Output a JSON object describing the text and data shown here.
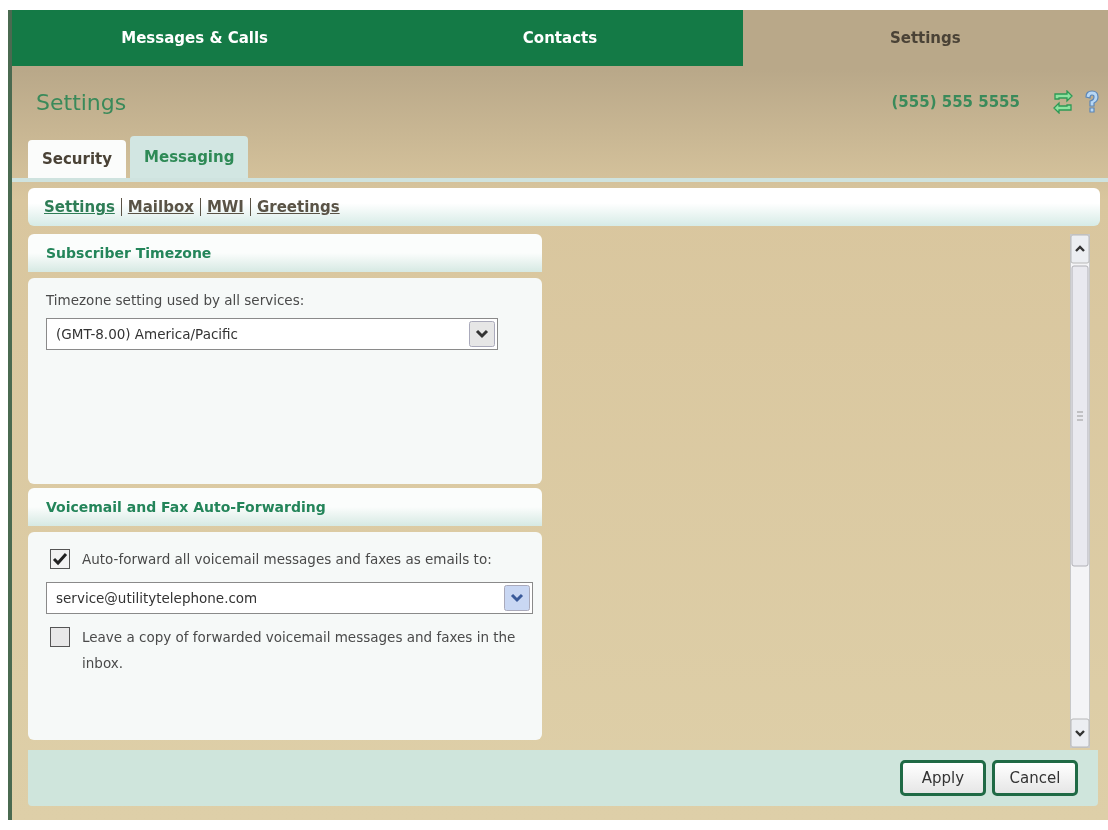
{
  "top_tabs": [
    {
      "label": "Messages & Calls",
      "selected": false
    },
    {
      "label": "Contacts",
      "selected": false
    },
    {
      "label": "Settings",
      "selected": true
    }
  ],
  "page": {
    "title": "Settings",
    "phone": "(555) 555 5555"
  },
  "sub_tabs": [
    {
      "label": "Security",
      "selected": false
    },
    {
      "label": "Messaging",
      "selected": true
    }
  ],
  "links": [
    {
      "label": "Settings",
      "selected": true
    },
    {
      "label": "Mailbox",
      "selected": false
    },
    {
      "label": "MWI",
      "selected": false
    },
    {
      "label": "Greetings",
      "selected": false
    }
  ],
  "sections": [
    {
      "title": "Subscriber Timezone",
      "items": [
        {
          "kind": "label",
          "text": "Timezone setting used by all services:"
        },
        {
          "kind": "select",
          "value": "(GMT-8.00) America/Pacific"
        }
      ]
    },
    {
      "title": "Voicemail and Fax Auto-Forwarding",
      "items": [
        {
          "kind": "checkbox",
          "checked": true,
          "text": "Auto-forward all voicemail messages and faxes as emails to:"
        },
        {
          "kind": "select",
          "value": "service@utilitytelephone.com"
        },
        {
          "kind": "checkbox",
          "checked": false,
          "text": "Leave a copy of forwarded voicemail messages and faxes in the inbox."
        }
      ]
    }
  ],
  "buttons": [
    "Apply",
    "Cancel"
  ]
}
